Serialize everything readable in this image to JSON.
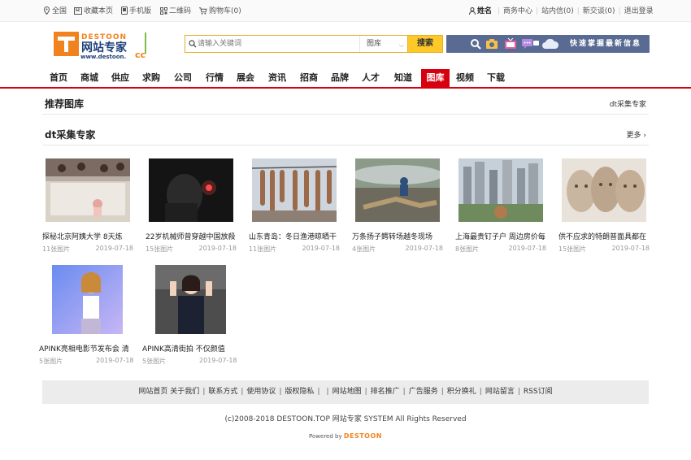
{
  "topbar": {
    "home": "全国",
    "favorite": "收藏本页",
    "mobile": "手机版",
    "qrcode": "二维码",
    "cart": "购物车(0)",
    "username": "姓名",
    "business_center": "商务中心",
    "messages": "站内信(0)",
    "new_chats": "新交谈(0)",
    "logout": "退出登录"
  },
  "logo": {
    "brand": "DESTOON",
    "name": "网站专家",
    "url": "www.destoon.",
    "suffix": "cc"
  },
  "search": {
    "placeholder": "请输入关键词",
    "category": "图库",
    "button": "搜索"
  },
  "banner": {
    "text": "快速掌握最新信息"
  },
  "nav": {
    "items": [
      "首页",
      "商城",
      "供应",
      "求购",
      "公司",
      "行情",
      "展会",
      "资讯",
      "招商",
      "品牌",
      "人才",
      "知道",
      "图库",
      "视频",
      "下载"
    ],
    "active_index": 12
  },
  "section_recommend": {
    "title": "推荐图库",
    "right": "dt采集专家"
  },
  "section_gallery": {
    "title": "dt采集专家",
    "more": "更多"
  },
  "gallery": [
    {
      "title": "探秘北京阿姨大学 8天炼",
      "count": "11张图片",
      "date": "2019-07-18"
    },
    {
      "title": "22岁机械师曾穿越中国放殺",
      "count": "15张图片",
      "date": "2019-07-18"
    },
    {
      "title": "山东青岛：冬日渔港晾晒干",
      "count": "11张图片",
      "date": "2019-07-18"
    },
    {
      "title": "万条扬子鳄转场越冬现场",
      "count": "4张图片",
      "date": "2019-07-18"
    },
    {
      "title": "上海最贵钉子户 周边房价每",
      "count": "8张图片",
      "date": "2019-07-18"
    },
    {
      "title": "供不应求的特朗普面具都在",
      "count": "15张图片",
      "date": "2019-07-18"
    },
    {
      "title": "APINK亮相电影节发布会 清",
      "count": "5张图片",
      "date": "2019-07-18"
    },
    {
      "title": "APINK高清街拍 不仅颜值",
      "count": "5张图片",
      "date": "2019-07-18"
    }
  ],
  "footer": {
    "links": [
      "网站首页",
      "关于我们",
      "联系方式",
      "使用协议",
      "版权隐私",
      "",
      "网站地图",
      "排名推广",
      "广告服务",
      "积分换礼",
      "网站留言",
      "RSS订阅"
    ],
    "copyright": "(c)2008-2018 DESTOON.TOP 网站专家 SYSTEM All Rights Reserved",
    "powered_label": "Powered by",
    "powered_brand": "DESTOON"
  },
  "colors": {
    "nav_active": "#d7000f",
    "search_button": "#ffc829",
    "banner_bg": "#5a6b93",
    "logo_orange": "#f0831e"
  }
}
